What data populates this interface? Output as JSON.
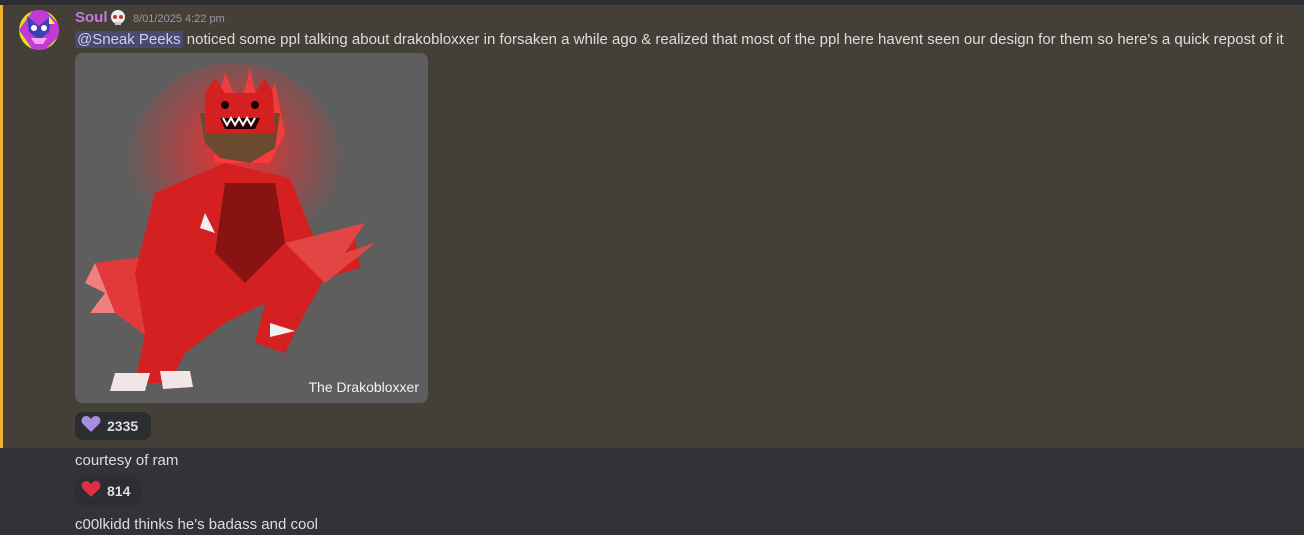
{
  "message": {
    "username": "Soul",
    "role_icon": "skull-icon",
    "timestamp": "8/01/2025 4:22 pm",
    "mention": "@Sneak Peeks",
    "text": " noticed some ppl talking about drakobloxxer in forsaken a while ago & realized that most of the ppl here havent seen our design for them so here's a quick repost of it",
    "attachment": {
      "caption": "The Drakobloxxer"
    },
    "reaction": {
      "emoji": "purple-heart-icon",
      "count": "2335",
      "color": "#a88ee0"
    }
  },
  "followups": [
    {
      "text": "courtesy of ram",
      "reaction": {
        "emoji": "red-heart-icon",
        "count": "814",
        "color": "#dd2e44"
      }
    },
    {
      "text": "c00lkidd thinks he's badass and cool"
    }
  ],
  "colors": {
    "username": "#c678dd",
    "highlight_bg": "#444037",
    "highlight_border": "#f0b232",
    "page_bg": "#313338"
  }
}
